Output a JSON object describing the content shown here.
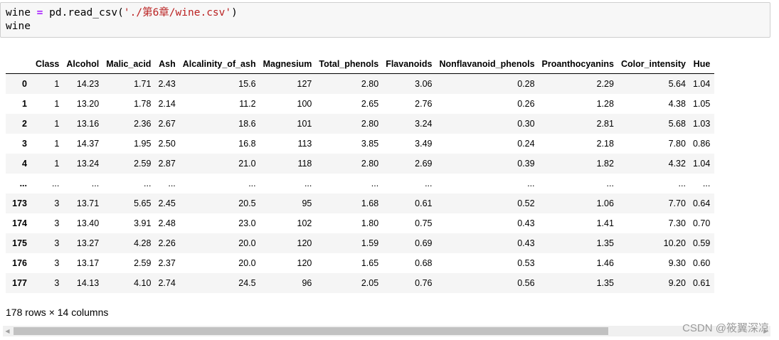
{
  "code_cell": {
    "line1": {
      "var": "wine",
      "op": "=",
      "call": "pd.read_csv(",
      "arg": "'./第6章/wine.csv'",
      "close": ")"
    },
    "line2": "wine"
  },
  "dataframe": {
    "columns": [
      "",
      "Class",
      "Alcohol",
      "Malic_acid",
      "Ash",
      "Alcalinity_of_ash",
      "Magnesium",
      "Total_phenols",
      "Flavanoids",
      "Nonflavanoid_phenols",
      "Proanthocyanins",
      "Color_intensity",
      "Hue"
    ],
    "rows": [
      [
        "0",
        "1",
        "14.23",
        "1.71",
        "2.43",
        "15.6",
        "127",
        "2.80",
        "3.06",
        "0.28",
        "2.29",
        "5.64",
        "1.04"
      ],
      [
        "1",
        "1",
        "13.20",
        "1.78",
        "2.14",
        "11.2",
        "100",
        "2.65",
        "2.76",
        "0.26",
        "1.28",
        "4.38",
        "1.05"
      ],
      [
        "2",
        "1",
        "13.16",
        "2.36",
        "2.67",
        "18.6",
        "101",
        "2.80",
        "3.24",
        "0.30",
        "2.81",
        "5.68",
        "1.03"
      ],
      [
        "3",
        "1",
        "14.37",
        "1.95",
        "2.50",
        "16.8",
        "113",
        "3.85",
        "3.49",
        "0.24",
        "2.18",
        "7.80",
        "0.86"
      ],
      [
        "4",
        "1",
        "13.24",
        "2.59",
        "2.87",
        "21.0",
        "118",
        "2.80",
        "2.69",
        "0.39",
        "1.82",
        "4.32",
        "1.04"
      ],
      [
        "...",
        "...",
        "...",
        "...",
        "...",
        "...",
        "...",
        "...",
        "...",
        "...",
        "...",
        "...",
        "..."
      ],
      [
        "173",
        "3",
        "13.71",
        "5.65",
        "2.45",
        "20.5",
        "95",
        "1.68",
        "0.61",
        "0.52",
        "1.06",
        "7.70",
        "0.64"
      ],
      [
        "174",
        "3",
        "13.40",
        "3.91",
        "2.48",
        "23.0",
        "102",
        "1.80",
        "0.75",
        "0.43",
        "1.41",
        "7.30",
        "0.70"
      ],
      [
        "175",
        "3",
        "13.27",
        "4.28",
        "2.26",
        "20.0",
        "120",
        "1.59",
        "0.69",
        "0.43",
        "1.35",
        "10.20",
        "0.59"
      ],
      [
        "176",
        "3",
        "13.17",
        "2.59",
        "2.37",
        "20.0",
        "120",
        "1.65",
        "0.68",
        "0.53",
        "1.46",
        "9.30",
        "0.60"
      ],
      [
        "177",
        "3",
        "14.13",
        "4.10",
        "2.74",
        "24.5",
        "96",
        "2.05",
        "0.76",
        "0.56",
        "1.35",
        "9.20",
        "0.61"
      ]
    ]
  },
  "summary": "178 rows × 14 columns",
  "scrollbar": {
    "left_arrow": "◀",
    "right_arrow": "▶"
  },
  "watermark": "CSDN @筱翼深凉",
  "colors": {
    "operator": "#aa22ff",
    "string": "#ba2121",
    "cell_bg": "#f7f7f7",
    "stripe": "#f5f5f5"
  }
}
